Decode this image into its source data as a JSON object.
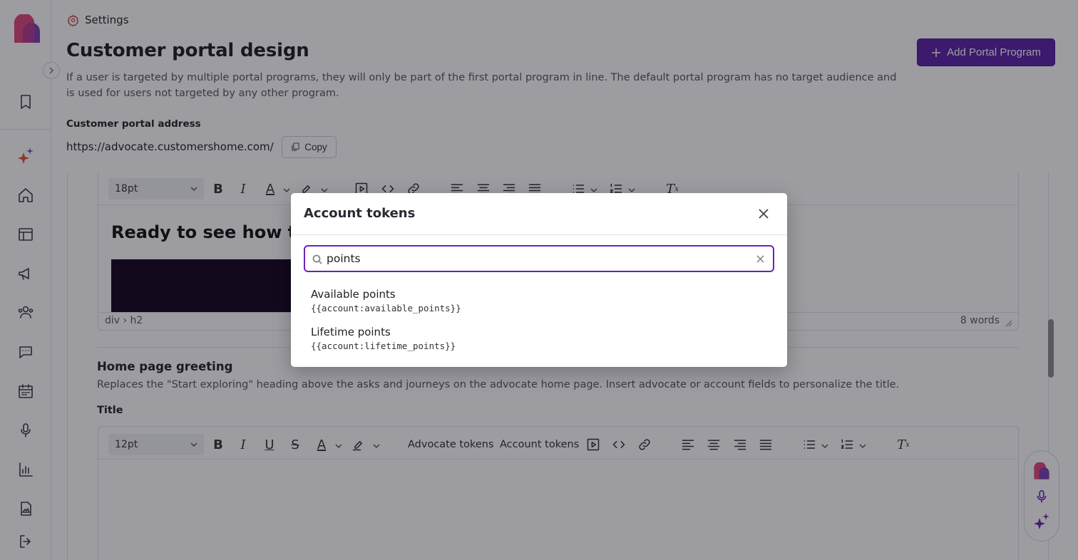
{
  "breadcrumb": {
    "label": "Settings"
  },
  "page": {
    "title": "Customer portal design",
    "description": "If a user is targeted by multiple portal programs, they will only be part of the first portal program in line. The default portal program has no target audience and is used for users not targeted by any other program.",
    "add_button": "Add Portal Program"
  },
  "portal_address": {
    "label": "Customer portal address",
    "url": "https://advocate.customershome.com/",
    "copy_label": "Copy"
  },
  "editor1": {
    "font_size": "18pt",
    "heading_text": "Ready to see how this",
    "path": "div › h2",
    "word_count": "8 words"
  },
  "greeting_section": {
    "title": "Home page greeting",
    "description": "Replaces the \"Start exploring\" heading above the asks and journeys on the advocate home page. Insert advocate or account fields to personalize the title.",
    "field_label": "Title"
  },
  "editor2": {
    "font_size": "12pt",
    "advocate_tokens": "Advocate tokens",
    "account_tokens": "Account tokens"
  },
  "modal": {
    "title": "Account tokens",
    "search_value": "points",
    "results": [
      {
        "name": "Available points",
        "token": "{{account:available_points}}"
      },
      {
        "name": "Lifetime points",
        "token": "{{account:lifetime_points}}"
      }
    ]
  },
  "colors": {
    "accent": "#5b1fa6",
    "focus_border": "#6b21b8",
    "settings_icon": "#c0392b"
  }
}
